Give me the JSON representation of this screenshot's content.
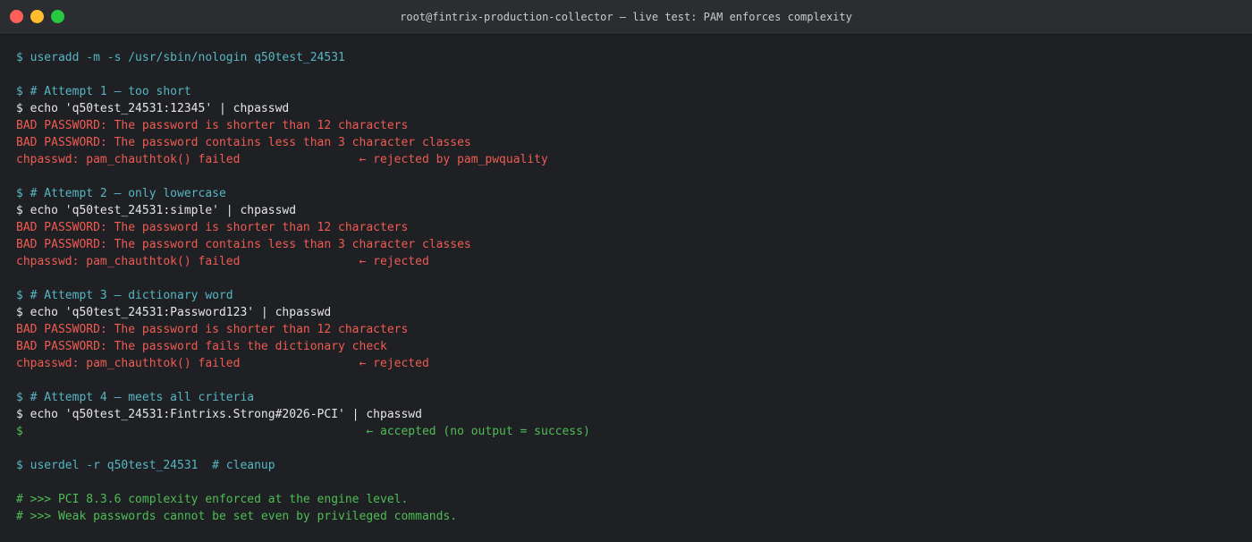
{
  "window": {
    "title": "root@fintrix-production-collector — live test: PAM enforces complexity"
  },
  "terminal": {
    "lines": [
      {
        "text": "$ useradd -m -s /usr/sbin/nologin q50test_24531",
        "color": "cyan"
      },
      {
        "text": "",
        "color": "blank"
      },
      {
        "text": "$ # Attempt 1 — too short",
        "color": "cyan"
      },
      {
        "text": "$ echo 'q50test_24531:12345' | chpasswd",
        "color": "white"
      },
      {
        "text": "BAD PASSWORD: The password is shorter than 12 characters",
        "color": "red"
      },
      {
        "text": "BAD PASSWORD: The password contains less than 3 character classes",
        "color": "red"
      },
      {
        "text": "chpasswd: pam_chauthtok() failed                 ← rejected by pam_pwquality",
        "color": "red"
      },
      {
        "text": "",
        "color": "blank"
      },
      {
        "text": "$ # Attempt 2 — only lowercase",
        "color": "cyan"
      },
      {
        "text": "$ echo 'q50test_24531:simple' | chpasswd",
        "color": "white"
      },
      {
        "text": "BAD PASSWORD: The password is shorter than 12 characters",
        "color": "red"
      },
      {
        "text": "BAD PASSWORD: The password contains less than 3 character classes",
        "color": "red"
      },
      {
        "text": "chpasswd: pam_chauthtok() failed                 ← rejected",
        "color": "red"
      },
      {
        "text": "",
        "color": "blank"
      },
      {
        "text": "$ # Attempt 3 — dictionary word",
        "color": "cyan"
      },
      {
        "text": "$ echo 'q50test_24531:Password123' | chpasswd",
        "color": "white"
      },
      {
        "text": "BAD PASSWORD: The password is shorter than 12 characters",
        "color": "red"
      },
      {
        "text": "BAD PASSWORD: The password fails the dictionary check",
        "color": "red"
      },
      {
        "text": "chpasswd: pam_chauthtok() failed                 ← rejected",
        "color": "red"
      },
      {
        "text": "",
        "color": "blank"
      },
      {
        "text": "$ # Attempt 4 — meets all criteria",
        "color": "cyan"
      },
      {
        "text": "$ echo 'q50test_24531:Fintrixs.Strong#2026-PCI' | chpasswd",
        "color": "white"
      },
      {
        "text": "$                                                 ← accepted (no output = success)",
        "color": "green"
      },
      {
        "text": "",
        "color": "blank"
      },
      {
        "text": "$ userdel -r q50test_24531  # cleanup",
        "color": "cyan"
      },
      {
        "text": "",
        "color": "blank"
      },
      {
        "text": "# >>> PCI 8.3.6 complexity enforced at the engine level.",
        "color": "green"
      },
      {
        "text": "# >>> Weak passwords cannot be set even by privileged commands.",
        "color": "green"
      }
    ]
  },
  "colors": {
    "cyan": "#56b6c2",
    "white": "#e6e6e6",
    "red": "#ef5b52",
    "green": "#4fbd55",
    "background": "#1e2024",
    "titlebar": "#2b2d31"
  }
}
